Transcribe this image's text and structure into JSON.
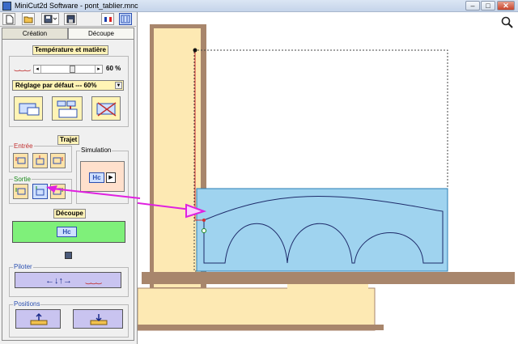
{
  "window": {
    "title": "MiniCut2d Software - pont_tablier.mnc",
    "minimize": "–",
    "maximize": "□",
    "close": "✕"
  },
  "toolbar": {
    "new_icon": "new-file-icon",
    "open_icon": "open-folder-icon",
    "save_icon": "save-icon",
    "save_as_icon": "save-as-icon",
    "flag_icon": "flag-icon",
    "mode_icon": "machine-mode-icon"
  },
  "tabs": {
    "creation": "Création",
    "decoupe": "Découpe"
  },
  "temperature": {
    "header": "Température et matière",
    "value": "60 %",
    "level_fraction": 0.6,
    "preset_selected": "Réglage par défaut --- 60%",
    "thermo_glyph": "‿‿‿"
  },
  "trajet": {
    "header": "Trajet",
    "entree": "Entrée",
    "sortie": "Sortie",
    "simulation": "Simulation"
  },
  "decoupe": {
    "header": "Découpe",
    "cut_glyph": "Hc"
  },
  "piloter": {
    "title": "Piloter",
    "arrows": "←↓↑→",
    "thermo_glyph": "‿‿‿"
  },
  "positions": {
    "title": "Positions"
  },
  "canvas": {
    "zoom_icon": "magnifier-icon"
  },
  "colors": {
    "wood": "#a8866c",
    "foam_yellow": "#fde9b3",
    "path_blue": "#9fd3ef",
    "arrow_magenta": "#e020e0",
    "accent_green": "#7ff07a"
  }
}
